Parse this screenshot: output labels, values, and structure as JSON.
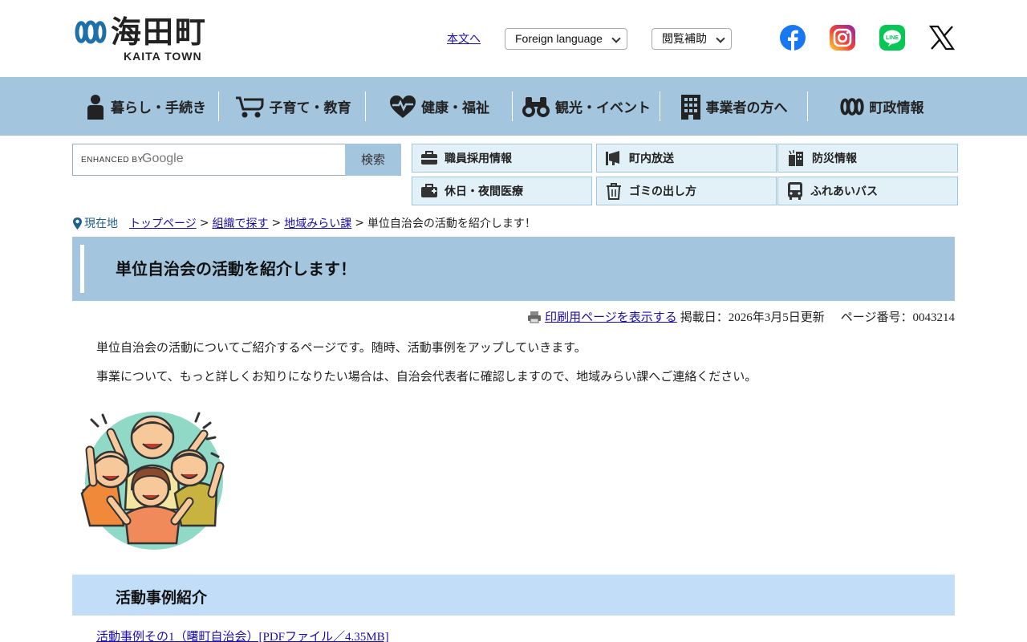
{
  "header": {
    "logo_ja": "海田町",
    "logo_en": "KAITA TOWN",
    "skip_link": "本文へ",
    "language_select": "Foreign language",
    "assist_select": "閲覧補助"
  },
  "sns": [
    "facebook-icon",
    "instagram-icon",
    "line-icon",
    "x-icon"
  ],
  "nav": {
    "items": [
      {
        "label": "暮らし・手続き",
        "icon": "person-icon"
      },
      {
        "label": "子育て・教育",
        "icon": "stroller-icon"
      },
      {
        "label": "健康・福祉",
        "icon": "heart-pulse-icon"
      },
      {
        "label": "観光・イベント",
        "icon": "binoculars-icon"
      },
      {
        "label": "事業者の方へ",
        "icon": "building-icon"
      },
      {
        "label": "町政情報",
        "icon": "town-logo-icon"
      }
    ]
  },
  "search": {
    "enhanced_by": "ENHANCED BY",
    "google": "Google",
    "button": "検索"
  },
  "quick_links": [
    {
      "label": "職員採用情報",
      "icon": "briefcase-icon"
    },
    {
      "label": "町内放送",
      "icon": "megaphone-icon"
    },
    {
      "label": "防災情報",
      "icon": "disaster-icon"
    },
    {
      "label": "休日・夜間医療",
      "icon": "medical-kit-icon"
    },
    {
      "label": "ゴミの出し方",
      "icon": "trash-icon"
    },
    {
      "label": "ふれあいバス",
      "icon": "bus-icon"
    }
  ],
  "breadcrumb": {
    "here_label": "現在地",
    "items": [
      "トップページ",
      "組織で探す",
      "地域みらい課"
    ],
    "current": "単位自治会の活動を紹介します！"
  },
  "page": {
    "title": "単位自治会の活動を紹介します！",
    "print_link": "印刷用ページを表示する",
    "posted": "掲載日：2026年3月5日更新",
    "page_number": "ページ番号：0043214",
    "para1": "単位自治会の活動についてご紹介するページです。随時、活動事例をアップしていきます。",
    "para2": "事業について、もっと詳しくお知りになりたい場合は、自治会代表者に確認しますので、地域みらい課へご連絡ください。",
    "section_heading": "活動事例紹介",
    "pdf_link": "活動事例その1（曙町自治会）[PDFファイル／4.35MB]"
  },
  "colors": {
    "nav_bg": "#a3c5de",
    "quick_bg": "#e2f1f7",
    "sub_heading_bg": "#c1ddf8",
    "link": "#1a0dab"
  }
}
